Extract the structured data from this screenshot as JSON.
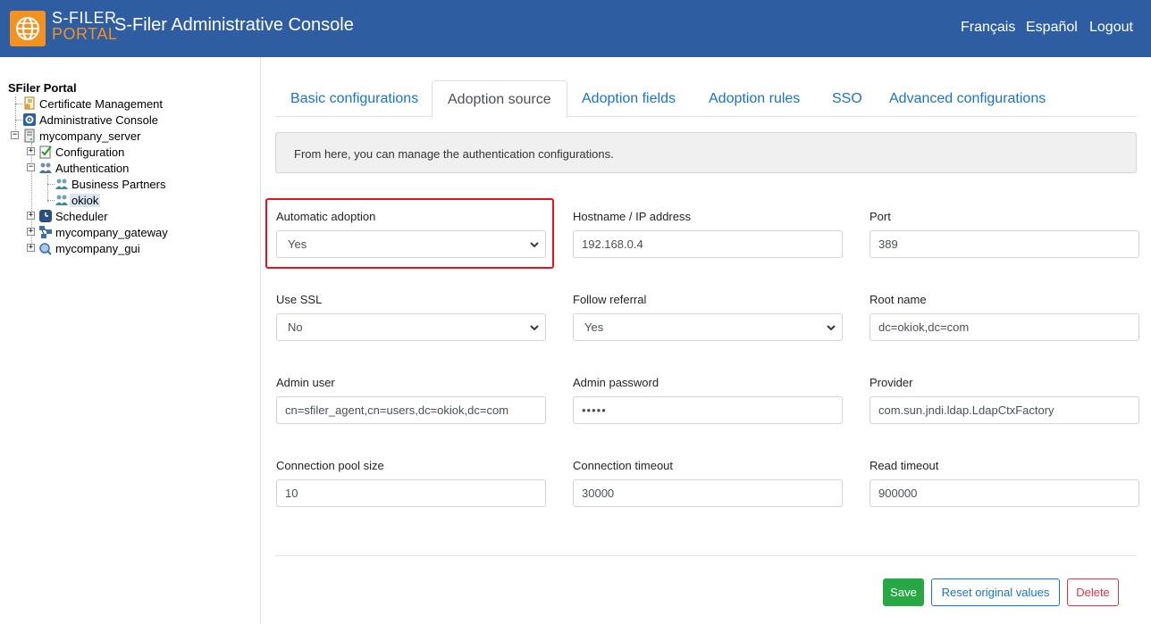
{
  "header": {
    "logo_line1": "S-FILER",
    "logo_line2": "PORTAL",
    "title": "S-Filer Administrative Console",
    "links": [
      "Français",
      "Español",
      "Logout"
    ]
  },
  "sidebar": {
    "root": "SFiler Portal",
    "items": {
      "cert": "Certificate Management",
      "admin_console": "Administrative Console",
      "server": "mycompany_server",
      "configuration": "Configuration",
      "authentication": "Authentication",
      "business_partners": "Business Partners",
      "okiok": "okiok",
      "scheduler": "Scheduler",
      "gateway": "mycompany_gateway",
      "gui": "mycompany_gui"
    }
  },
  "tabs": [
    "Basic configurations",
    "Adoption source",
    "Adoption fields",
    "Adoption rules",
    "SSO",
    "Advanced configurations"
  ],
  "active_tab": "Adoption source",
  "info_text": "From here, you can manage the authentication configurations.",
  "form": {
    "automatic_adoption": {
      "label": "Automatic adoption",
      "value": "Yes"
    },
    "hostname": {
      "label": "Hostname / IP address",
      "value": "192.168.0.4"
    },
    "port": {
      "label": "Port",
      "value": "389"
    },
    "use_ssl": {
      "label": "Use SSL",
      "value": "No"
    },
    "follow_referral": {
      "label": "Follow referral",
      "value": "Yes"
    },
    "root_name": {
      "label": "Root name",
      "value": "dc=okiok,dc=com"
    },
    "admin_user": {
      "label": "Admin user",
      "value": "cn=sfiler_agent,cn=users,dc=okiok,dc=com"
    },
    "admin_password": {
      "label": "Admin password",
      "value": "•••••"
    },
    "provider": {
      "label": "Provider",
      "value": "com.sun.jndi.ldap.LdapCtxFactory"
    },
    "connection_pool_size": {
      "label": "Connection pool size",
      "value": "10"
    },
    "connection_timeout": {
      "label": "Connection timeout",
      "value": "30000"
    },
    "read_timeout": {
      "label": "Read timeout",
      "value": "900000"
    }
  },
  "buttons": {
    "save": "Save",
    "reset": "Reset original values",
    "delete": "Delete"
  },
  "colors": {
    "header_bg": "#2f5da1",
    "brand_orange": "#f39221",
    "link_blue": "#1a73c8",
    "save_green": "#28a745",
    "delete_red": "#dc3545",
    "highlight_red": "#e5131d"
  },
  "icons": {
    "logo": "globe-icon",
    "select_arrow": "chevron-down-icon"
  }
}
